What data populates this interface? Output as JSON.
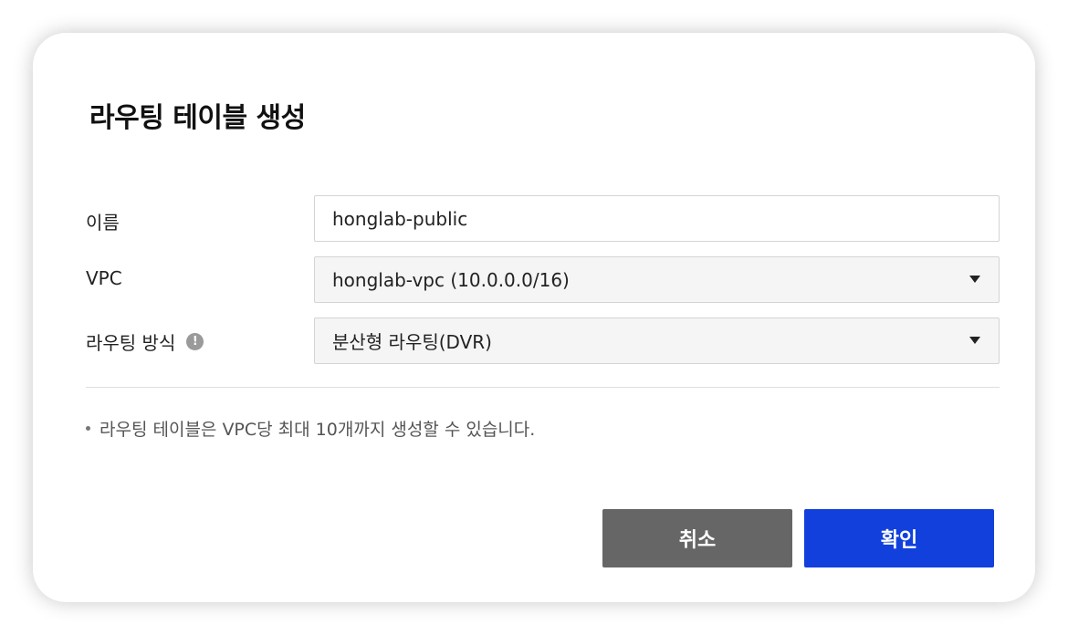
{
  "dialog": {
    "title": "라우팅 테이블 생성",
    "fields": {
      "name": {
        "label": "이름",
        "value": "honglab-public"
      },
      "vpc": {
        "label": "VPC",
        "value": "honglab-vpc (10.0.0.0/16)"
      },
      "routing": {
        "label": "라우팅 방식",
        "value": "분산형 라우팅(DVR)",
        "info_icon": "!"
      }
    },
    "note": "라우팅 테이블은 VPC당 최대 10개까지 생성할 수 있습니다.",
    "buttons": {
      "cancel": "취소",
      "ok": "확인"
    }
  },
  "colors": {
    "primary_button": "#1140dd",
    "secondary_button": "#666666",
    "select_background": "#f5f5f5"
  },
  "icons": {
    "info": "exclamation-circle-icon",
    "dropdown": "chevron-down-icon"
  }
}
